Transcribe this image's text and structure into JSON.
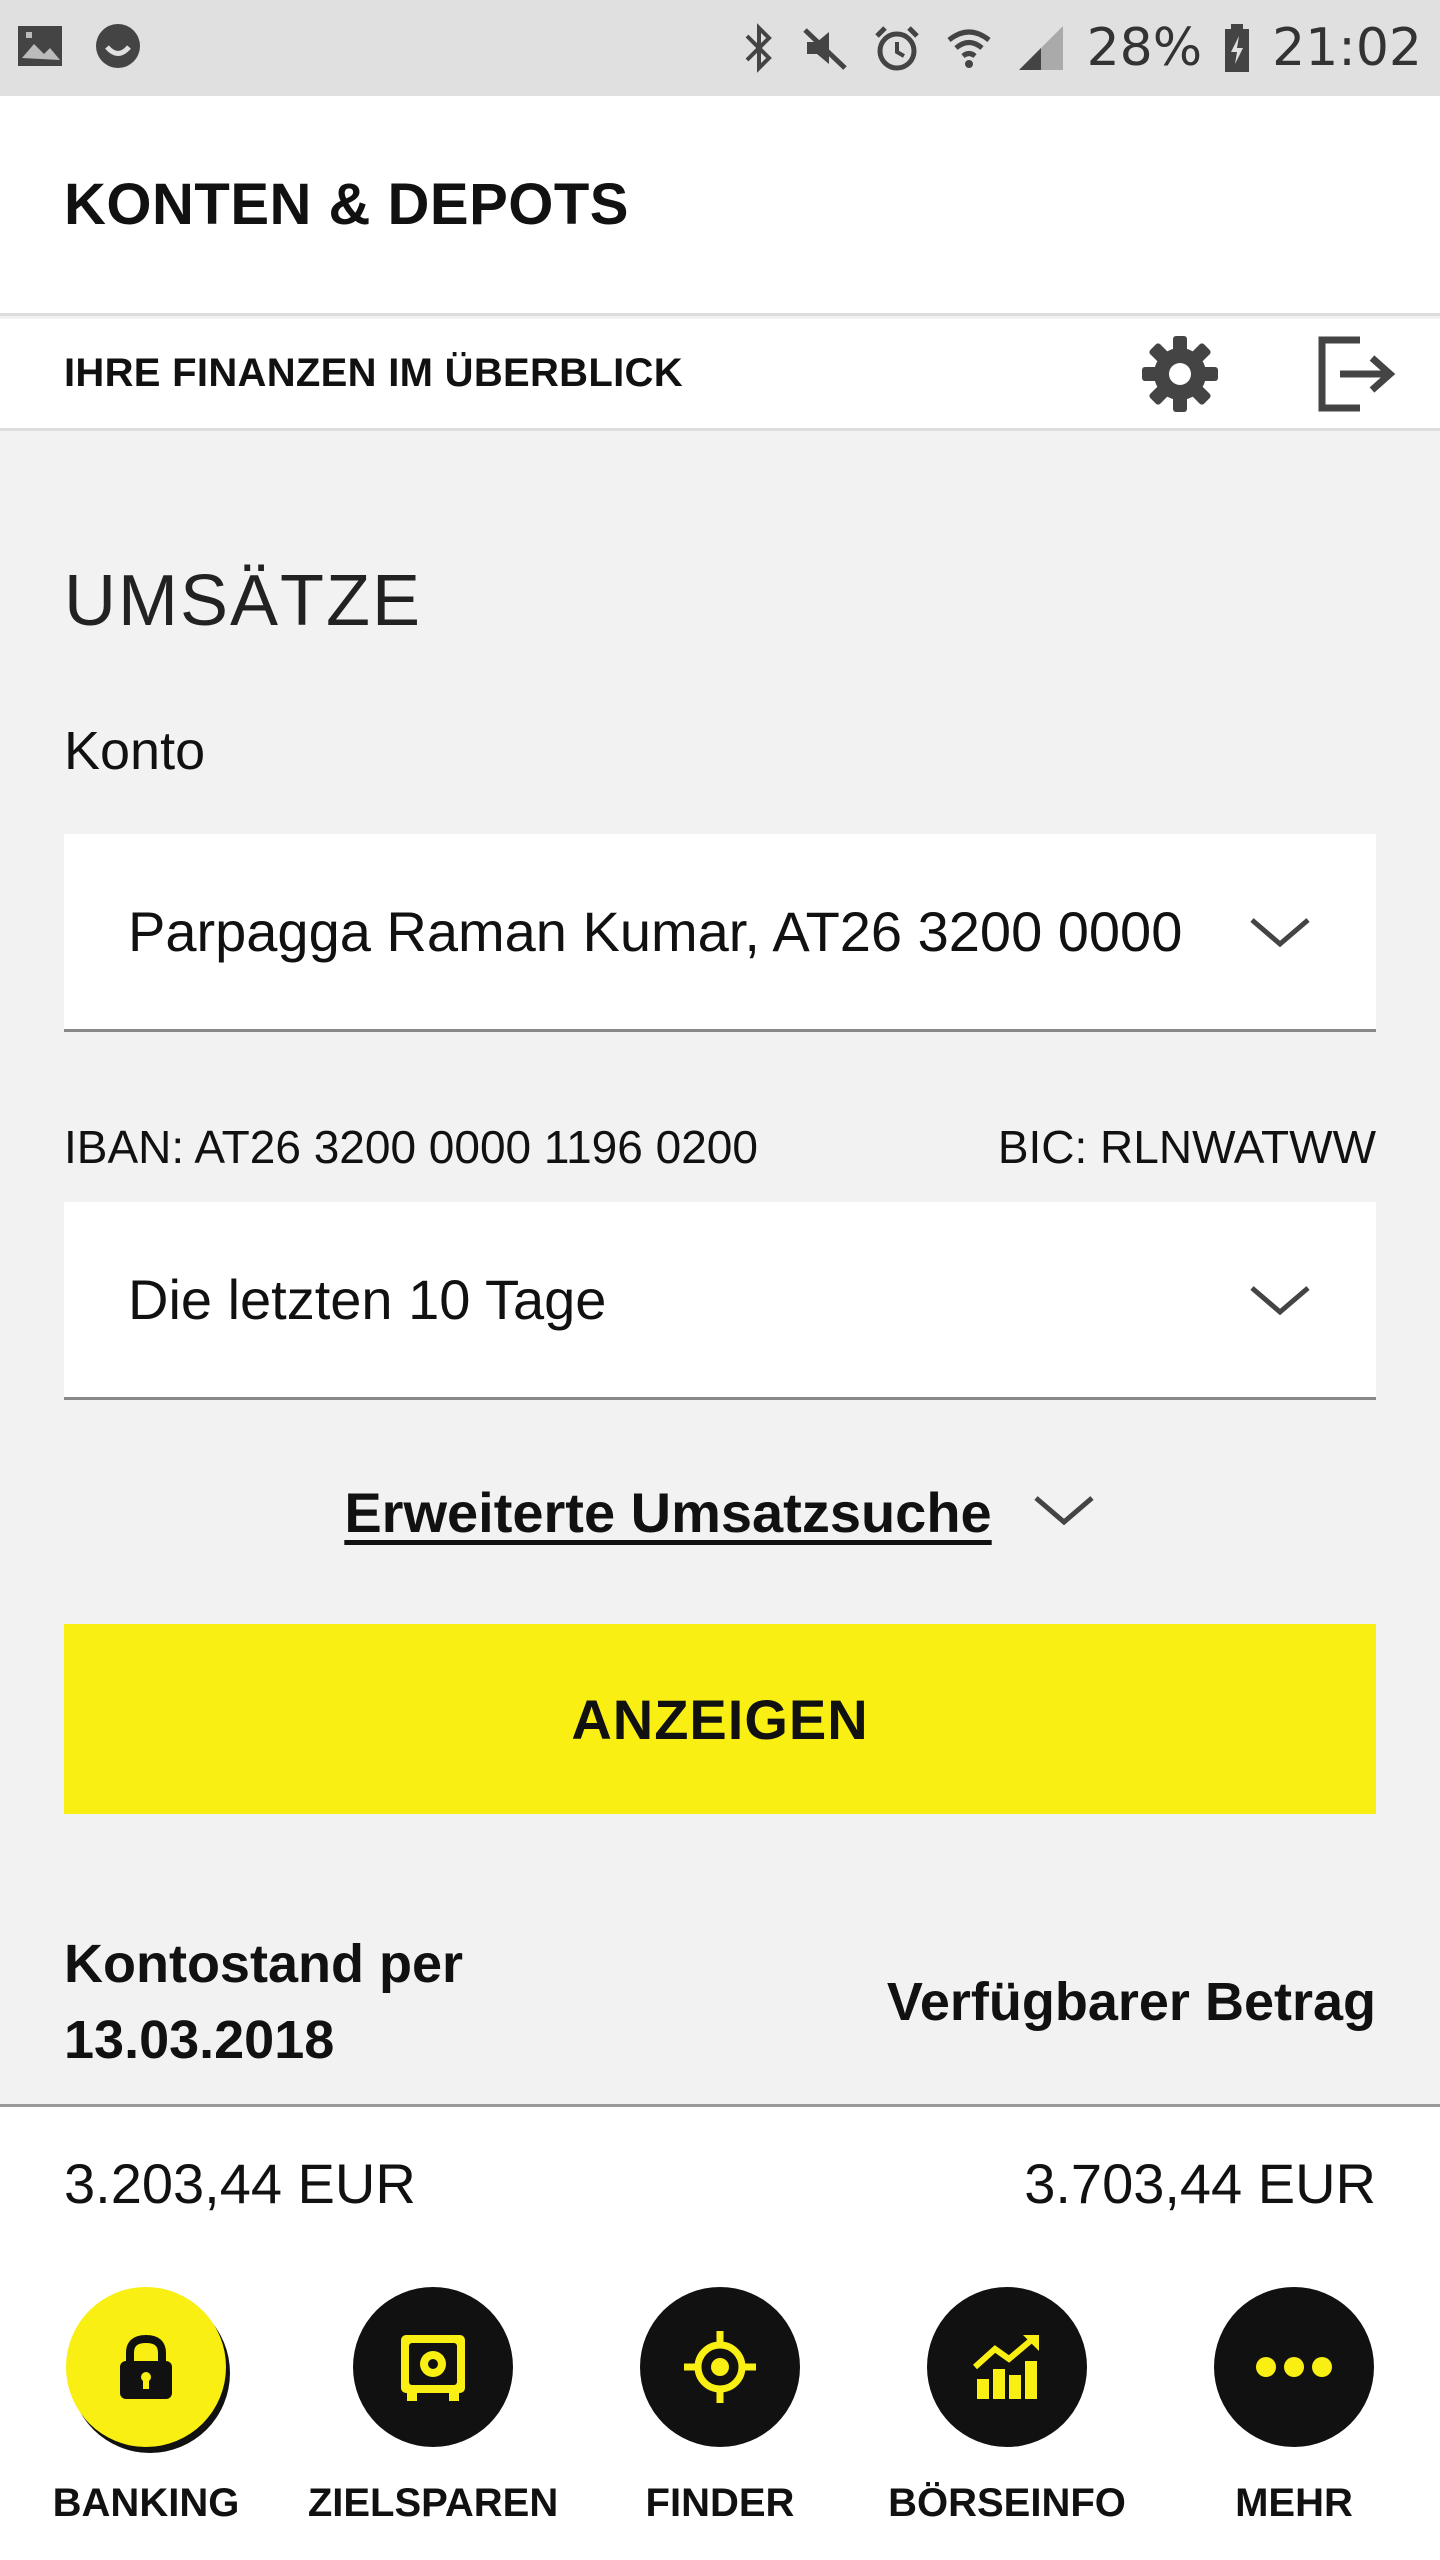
{
  "status_bar": {
    "battery": "28%",
    "time": "21:02",
    "icons": [
      "gallery-icon",
      "smiley-icon",
      "bluetooth-icon",
      "mute-icon",
      "alarm-icon",
      "wifi-icon",
      "signal-icon",
      "battery-charging-icon"
    ]
  },
  "header": {
    "title": "KONTEN & DEPOTS"
  },
  "subheader": {
    "title": "IHRE FINANZEN IM ÜBERBLICK",
    "icons": [
      "gear-icon",
      "logout-icon"
    ]
  },
  "main": {
    "section_title": "UMSÄTZE",
    "konto_label": "Konto",
    "account_dropdown": "Parpagga Raman Kumar, AT26 3200 0000",
    "iban": "IBAN: AT26 3200 0000 1196 0200",
    "bic": "BIC: RLNWATWW",
    "period_dropdown": "Die letzten 10 Tage",
    "advanced_search": "Erweiterte Umsatzsuche",
    "show_button": "ANZEIGEN",
    "balance_label": "Kontostand per 13.03.2018",
    "available_label": "Verfügbarer Betrag",
    "balance_value": "3.203,44 EUR",
    "available_value": "3.703,44 EUR"
  },
  "nav": {
    "items": [
      {
        "label": "BANKING",
        "icon": "lock-icon"
      },
      {
        "label": "ZIELSPAREN",
        "icon": "safe-icon"
      },
      {
        "label": "FINDER",
        "icon": "location-target-icon"
      },
      {
        "label": "BÖRSEINFO",
        "icon": "stock-chart-icon"
      },
      {
        "label": "MEHR",
        "icon": "more-dots-icon"
      }
    ]
  },
  "colors": {
    "accent": "#f9ef13",
    "background": "#f2f2f2",
    "nav_circle": "#111111"
  }
}
